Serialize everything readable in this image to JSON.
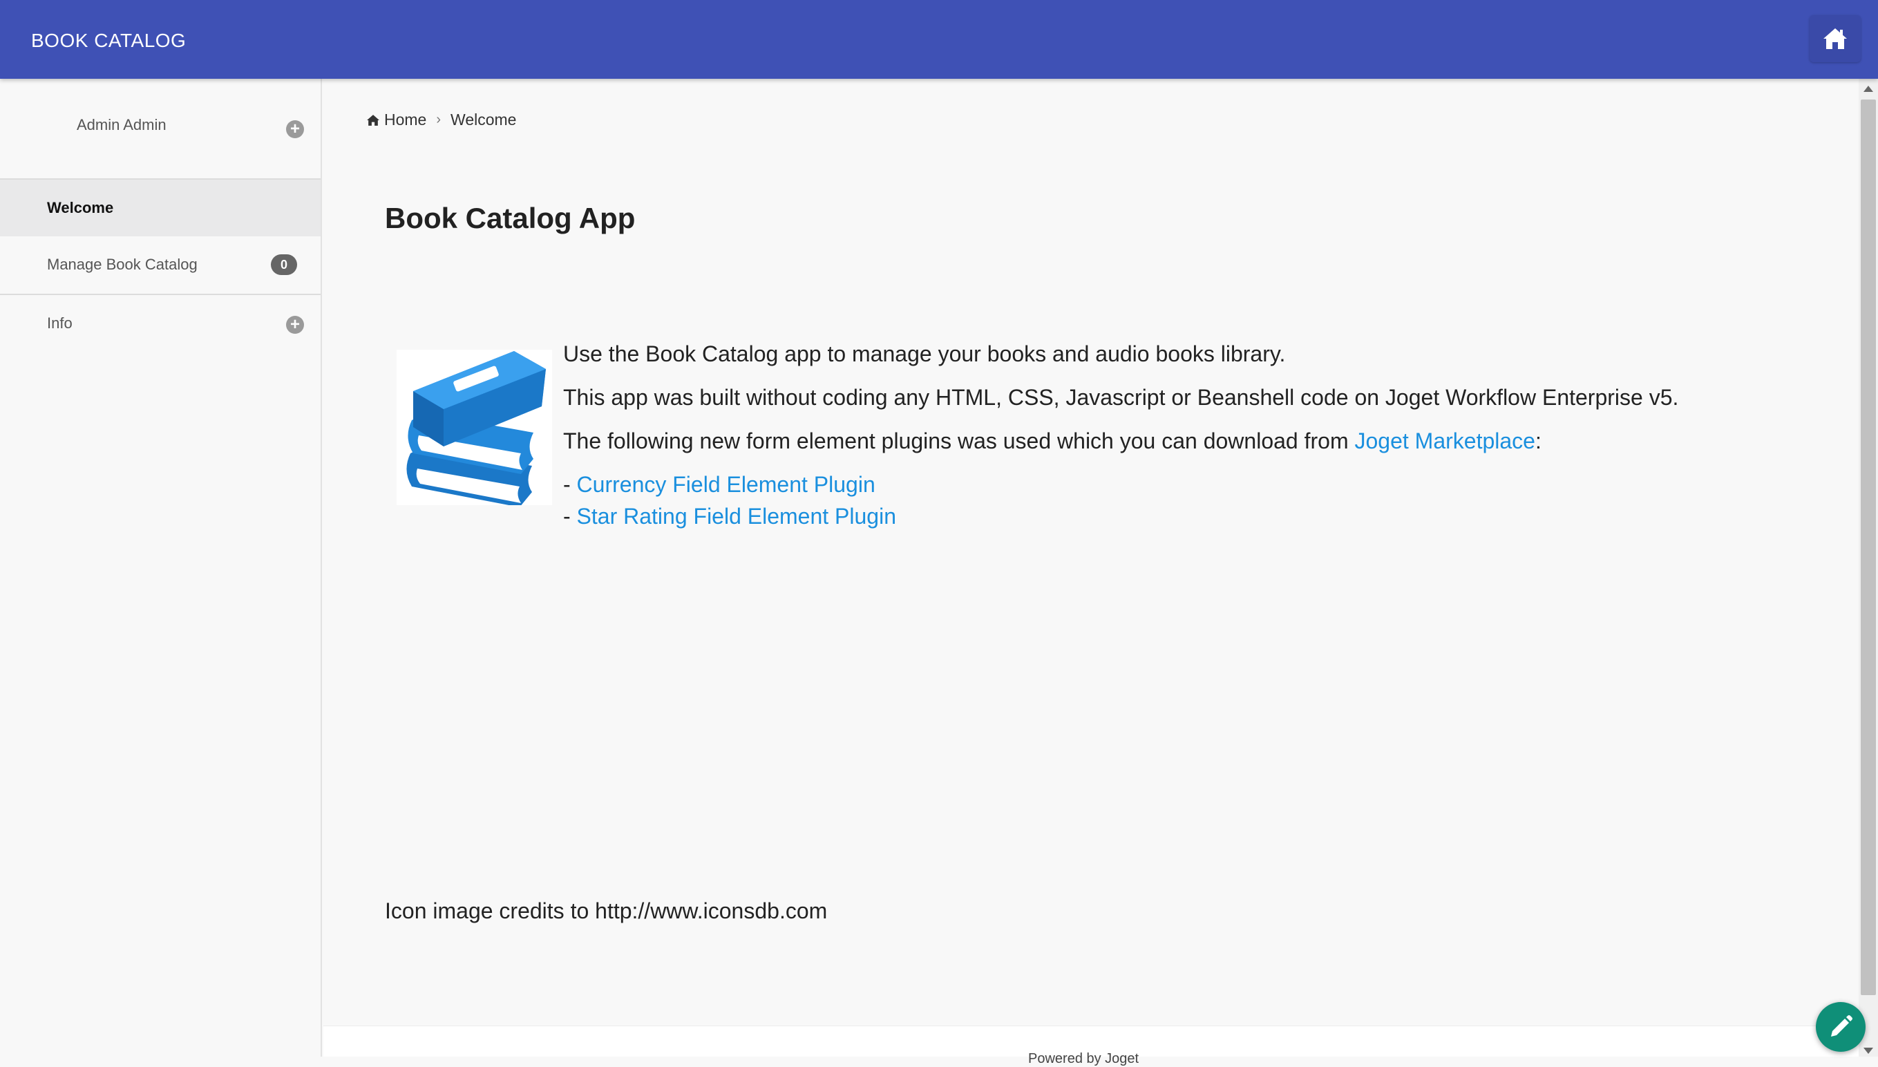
{
  "header": {
    "brand": "BOOK CATALOG",
    "home_icon": "home-icon"
  },
  "sidebar": {
    "user_name": "Admin Admin",
    "items": [
      {
        "label": "Welcome",
        "active": true
      },
      {
        "label": "Manage Book Catalog",
        "badge": "0"
      },
      {
        "label": "Info"
      }
    ]
  },
  "breadcrumb": {
    "home": "Home",
    "current": "Welcome"
  },
  "main": {
    "title": "Book Catalog App",
    "line1": "Use the Book Catalog app to manage your books and audio books library.",
    "line2": "This app was built without coding any HTML, CSS, Javascript or Beanshell code on Joget Workflow Enterprise v5.",
    "line3_prefix": "The following new form element plugins was used which you can download from ",
    "line3_link": "Joget Marketplace",
    "line3_suffix": ":",
    "plugins": [
      {
        "dash": "- ",
        "label": "Currency Field Element Plugin"
      },
      {
        "dash": "- ",
        "label": "Star Rating Field Element Plugin"
      }
    ],
    "credits": "Icon image credits to http://www.iconsdb.com"
  },
  "footer": {
    "text": "Powered by Joget"
  },
  "colors": {
    "header": "#3f51b5",
    "link": "#1a8fde",
    "fab": "#0f8f78",
    "book_icon": "#1b78c8"
  }
}
